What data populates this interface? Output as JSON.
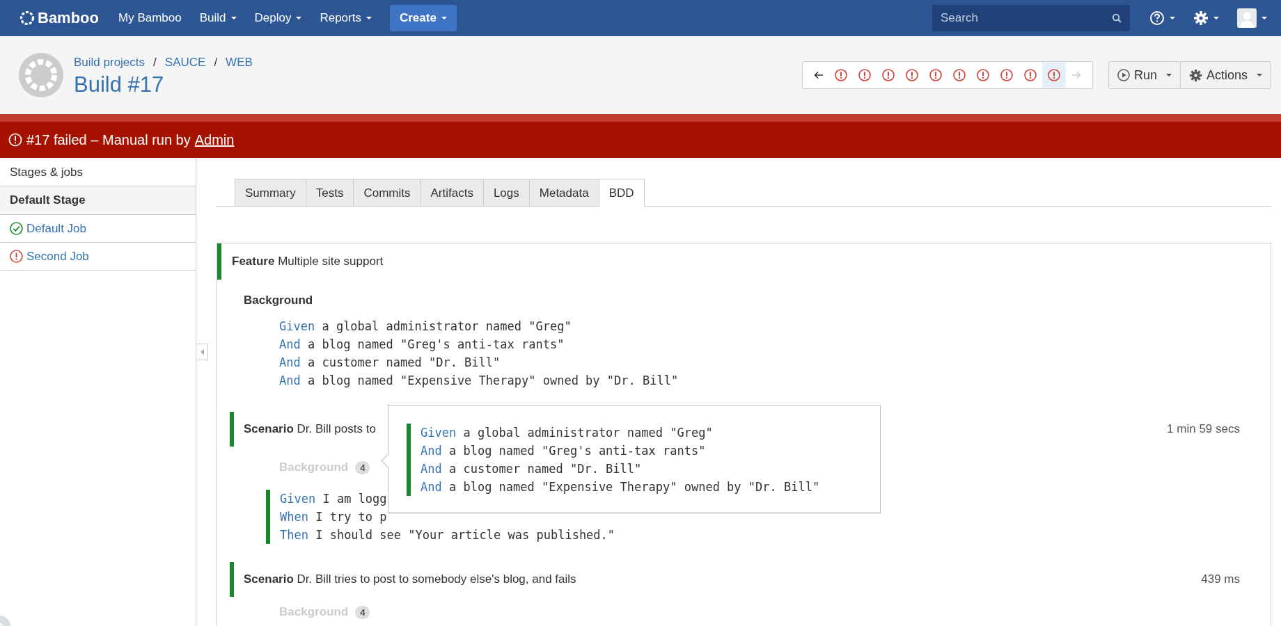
{
  "nav": {
    "logo": "Bamboo",
    "menu": [
      {
        "label": "My Bamboo",
        "dropdown": false
      },
      {
        "label": "Build",
        "dropdown": true
      },
      {
        "label": "Deploy",
        "dropdown": true
      },
      {
        "label": "Reports",
        "dropdown": true
      }
    ],
    "create": "Create",
    "search": {
      "placeholder": "Search"
    }
  },
  "header": {
    "breadcrumbs": [
      "Build projects",
      "SAUCE",
      "WEB"
    ],
    "separator": "/",
    "title": "Build #17",
    "history": {
      "prev_disabled": false,
      "next_disabled": true,
      "builds": [
        {
          "kind": "failed",
          "selected": false
        },
        {
          "kind": "failed",
          "selected": false
        },
        {
          "kind": "failed",
          "selected": false
        },
        {
          "kind": "failed",
          "selected": false
        },
        {
          "kind": "failed",
          "selected": false
        },
        {
          "kind": "failed",
          "selected": false
        },
        {
          "kind": "failed",
          "selected": false
        },
        {
          "kind": "failed",
          "selected": false
        },
        {
          "kind": "failed",
          "selected": false
        },
        {
          "kind": "failed",
          "selected": true
        }
      ]
    },
    "buttons": [
      {
        "label": "Run",
        "kind": "run"
      },
      {
        "label": "Actions",
        "kind": "actions"
      }
    ]
  },
  "banner": {
    "kind": "failed",
    "text": "#17 failed – Manual run by",
    "user": "Admin"
  },
  "sidebar": {
    "heading": "Stages & jobs",
    "stages": [
      {
        "name": "Default Stage",
        "jobs": [
          {
            "name": "Default Job",
            "kind": "success"
          },
          {
            "name": "Second Job",
            "kind": "failed"
          }
        ]
      }
    ]
  },
  "tabs": [
    {
      "label": "Summary",
      "selected": false
    },
    {
      "label": "Tests",
      "selected": false
    },
    {
      "label": "Commits",
      "selected": false
    },
    {
      "label": "Artifacts",
      "selected": false
    },
    {
      "label": "Logs",
      "selected": false
    },
    {
      "label": "Metadata",
      "selected": false
    },
    {
      "label": "BDD",
      "selected": true
    }
  ],
  "bdd": {
    "feature": {
      "keyword": "Feature",
      "name": "Multiple site support",
      "kind": "passed"
    },
    "background": {
      "title": "Background",
      "steps": [
        {
          "keyword": "Given",
          "text": "a global administrator named \"Greg\""
        },
        {
          "keyword": "And",
          "text": "a blog named \"Greg's anti-tax rants\""
        },
        {
          "keyword": "And",
          "text": "a customer named \"Dr. Bill\""
        },
        {
          "keyword": "And",
          "text": "a blog named \"Expensive Therapy\" owned by \"Dr. Bill\""
        }
      ]
    },
    "scenarios": [
      {
        "keyword": "Scenario",
        "name": "Dr. Bill posts to",
        "kind": "passed",
        "duration": "1 min 59 secs",
        "background": {
          "title": "Background",
          "count": "4"
        },
        "steps": [
          {
            "keyword": "Given",
            "text": "I am logg",
            "kind": "passed"
          },
          {
            "keyword": "When",
            "text": "I try to p",
            "kind": "passed"
          },
          {
            "keyword": "Then",
            "text": "I should see \"Your article was published.\"",
            "kind": "passed"
          }
        ],
        "popover": {
          "kind": "passed",
          "steps": [
            {
              "keyword": "Given",
              "text": "a global administrator named \"Greg\""
            },
            {
              "keyword": "And",
              "text": "a blog named \"Greg's anti-tax rants\""
            },
            {
              "keyword": "And",
              "text": "a customer named \"Dr. Bill\""
            },
            {
              "keyword": "And",
              "text": "a blog named \"Expensive Therapy\" owned by \"Dr. Bill\""
            }
          ]
        }
      },
      {
        "keyword": "Scenario",
        "name": "Dr. Bill tries to post to somebody else's blog, and fails",
        "kind": "passed",
        "duration": "439 ms",
        "background": {
          "title": "Background",
          "count": "4"
        }
      }
    ]
  }
}
